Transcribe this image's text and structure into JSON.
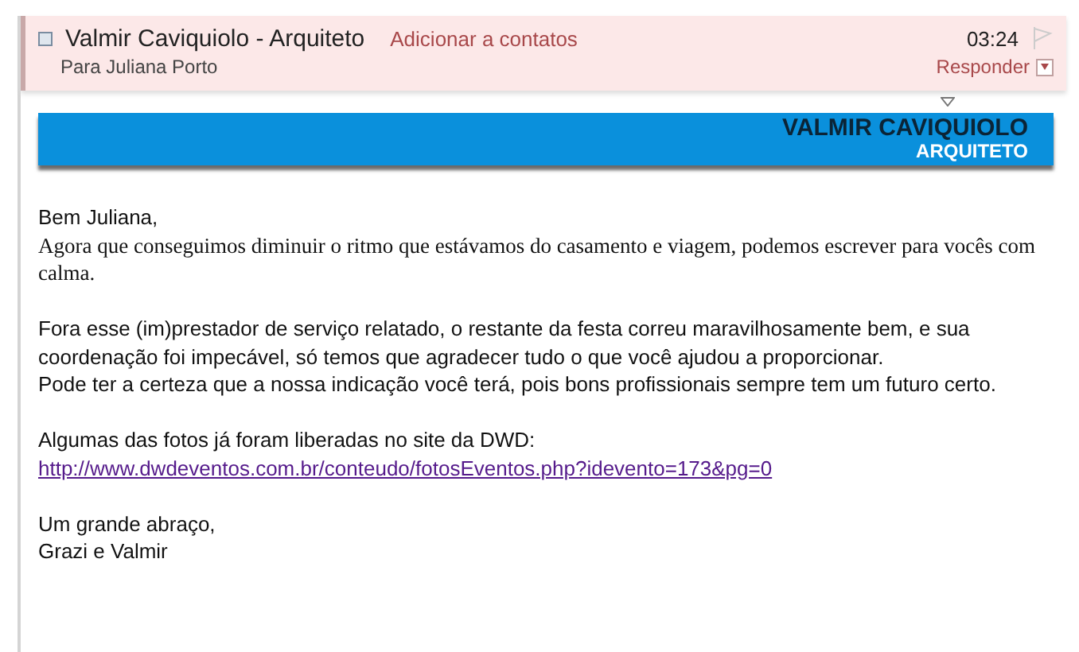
{
  "header": {
    "sender": "Valmir Caviquiolo - Arquiteto",
    "add_contact": "Adicionar a contatos",
    "recipient": "Para Juliana Porto",
    "time": "03:24",
    "flagged": false,
    "reply": "Responder"
  },
  "banner": {
    "name": "VALMIR CAVIQUIOLO",
    "profession": "ARQUITETO"
  },
  "body": [
    {
      "lines": [
        {
          "kind": "sans",
          "text": "Bem Juliana,"
        },
        {
          "kind": "serif",
          "text": "Agora que conseguimos diminuir o ritmo que estávamos do casamento e viagem, podemos escrever para vocês com calma."
        }
      ]
    },
    {
      "lines": [
        {
          "kind": "sans",
          "text": "Fora esse (im)prestador de serviço relatado, o restante da festa correu maravilhosamente bem, e sua coordenação foi impecável, só temos que agradecer tudo o que você ajudou a proporcionar."
        },
        {
          "kind": "sans",
          "text": "Pode ter a certeza que a nossa indicação você terá, pois bons profissionais sempre tem um futuro certo."
        }
      ]
    },
    {
      "lines": [
        {
          "kind": "sans",
          "text": "Algumas das fotos já foram liberadas no site da DWD:"
        },
        {
          "kind": "link",
          "text": "http://www.dwdeventos.com.br/conteudo/fotosEventos.php?idevento=173&pg=0"
        }
      ]
    },
    {
      "lines": [
        {
          "kind": "sans",
          "text": "Um grande abraço,"
        },
        {
          "kind": "sans",
          "text": "Grazi e Valmir"
        }
      ]
    }
  ]
}
